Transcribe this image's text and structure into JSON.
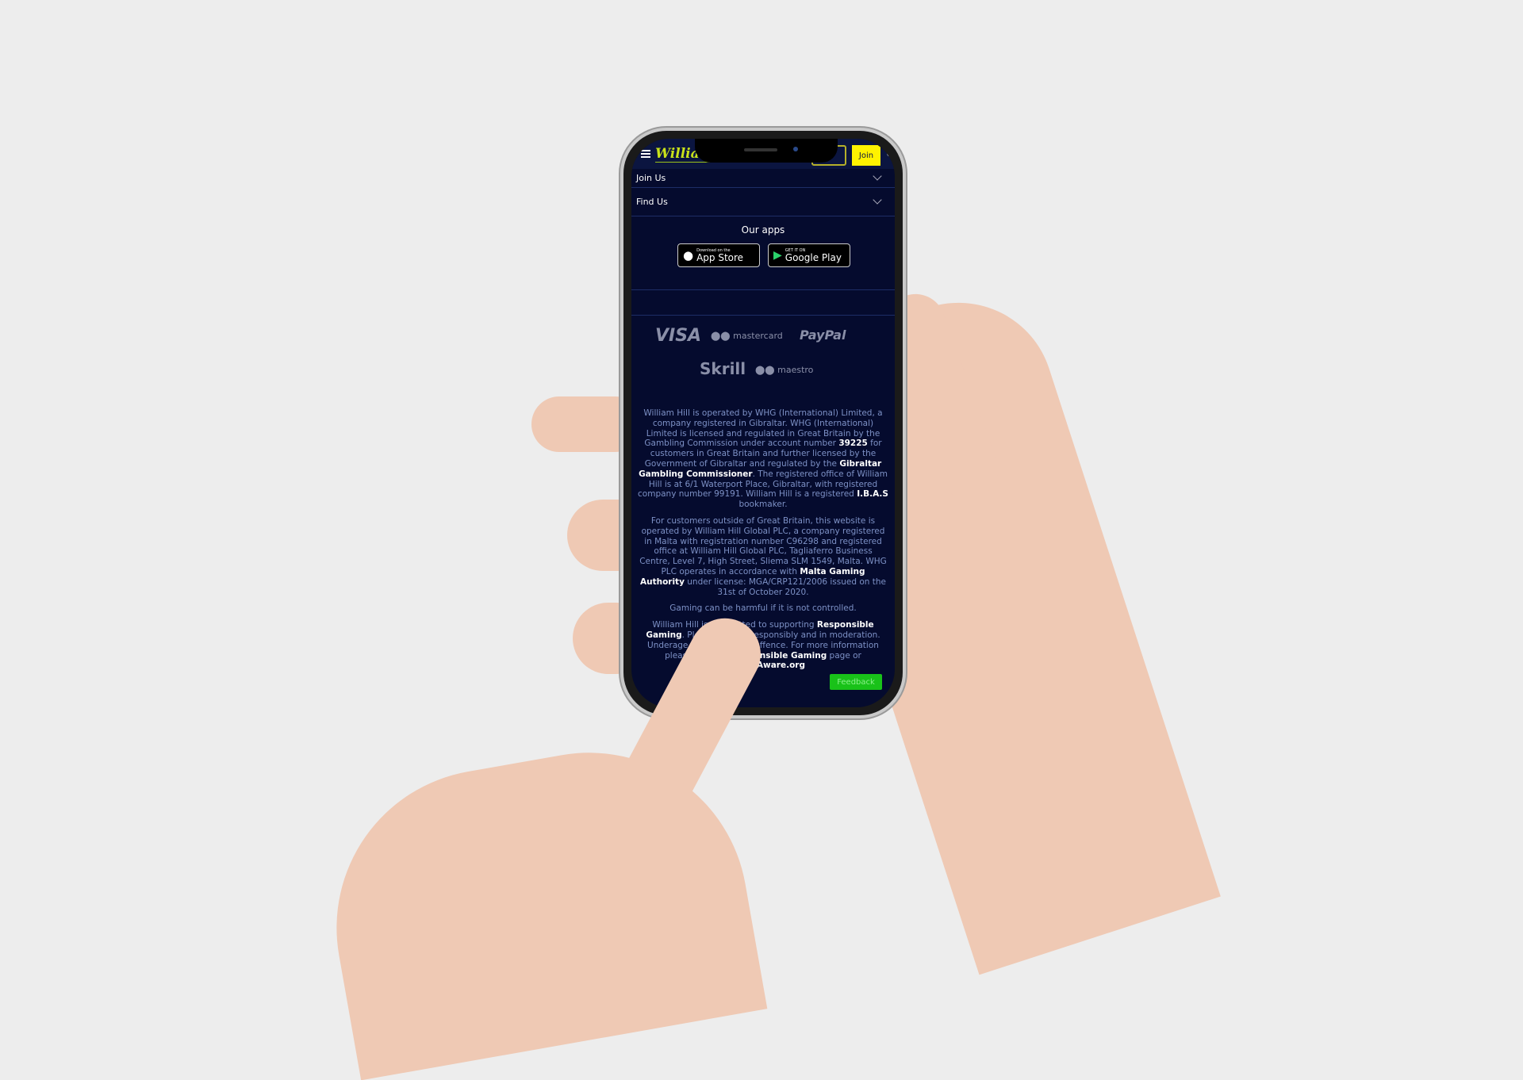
{
  "header": {
    "logo": "William Hill",
    "join_label": "Join"
  },
  "accordion": [
    {
      "label": "Join Us"
    },
    {
      "label": "Find Us"
    }
  ],
  "apps": {
    "title": "Our apps",
    "app_store": {
      "small": "Download on the",
      "big": "App Store"
    },
    "google_play": {
      "small": "GET IT ON",
      "big": "Google Play"
    }
  },
  "payments": [
    "VISA",
    "mastercard",
    "PayPal",
    "Skrill",
    "maestro"
  ],
  "legal": {
    "p1a": "William Hill is operated by WHG (International) Limited, a company registered in Gibraltar.  WHG (International) Limited is licensed and regulated in Great Britain by the Gambling Commission under account number ",
    "p1b": "39225",
    "p1c": " for customers in Great Britain and further licensed by the Government of Gibraltar and regulated by the ",
    "p1d": "Gibraltar Gambling Commissioner",
    "p1e": ". The registered office of William Hill is at 6/1 Waterport Place, Gibraltar, with registered company number 99191.  William Hill is a registered ",
    "p1f": "I.B.A.S",
    "p1g": " bookmaker.",
    "p2a": "For customers outside of Great Britain, this website is operated by William Hill Global PLC, a company registered in Malta with registration number C96298 and registered office at William Hill Global PLC, Tagliaferro Business Centre, Level 7, High Street, Sliema SLM 1549, Malta.  WHG PLC operates in accordance with ",
    "p2b": "Malta Gaming Authority",
    "p2c": " under license: MGA/CRP121/2006 issued on the 31st of October 2020.",
    "p3": "Gaming can be harmful if it is not controlled.",
    "p4a": "William Hill is committed to supporting ",
    "p4b": "Responsible Gaming",
    "p4c": ". Please gamble responsibly and in moderation. Underage gambling is an offence. For more information please visit our ",
    "p4d": "Responsible Gaming",
    "p4e": " page or ",
    "p4f": "GambleAware.org"
  },
  "feedback_label": "Feedback",
  "colors": {
    "background": "#050b2e",
    "join": "#fff200",
    "feedback": "#19c219",
    "logo": "#c9e21a"
  }
}
